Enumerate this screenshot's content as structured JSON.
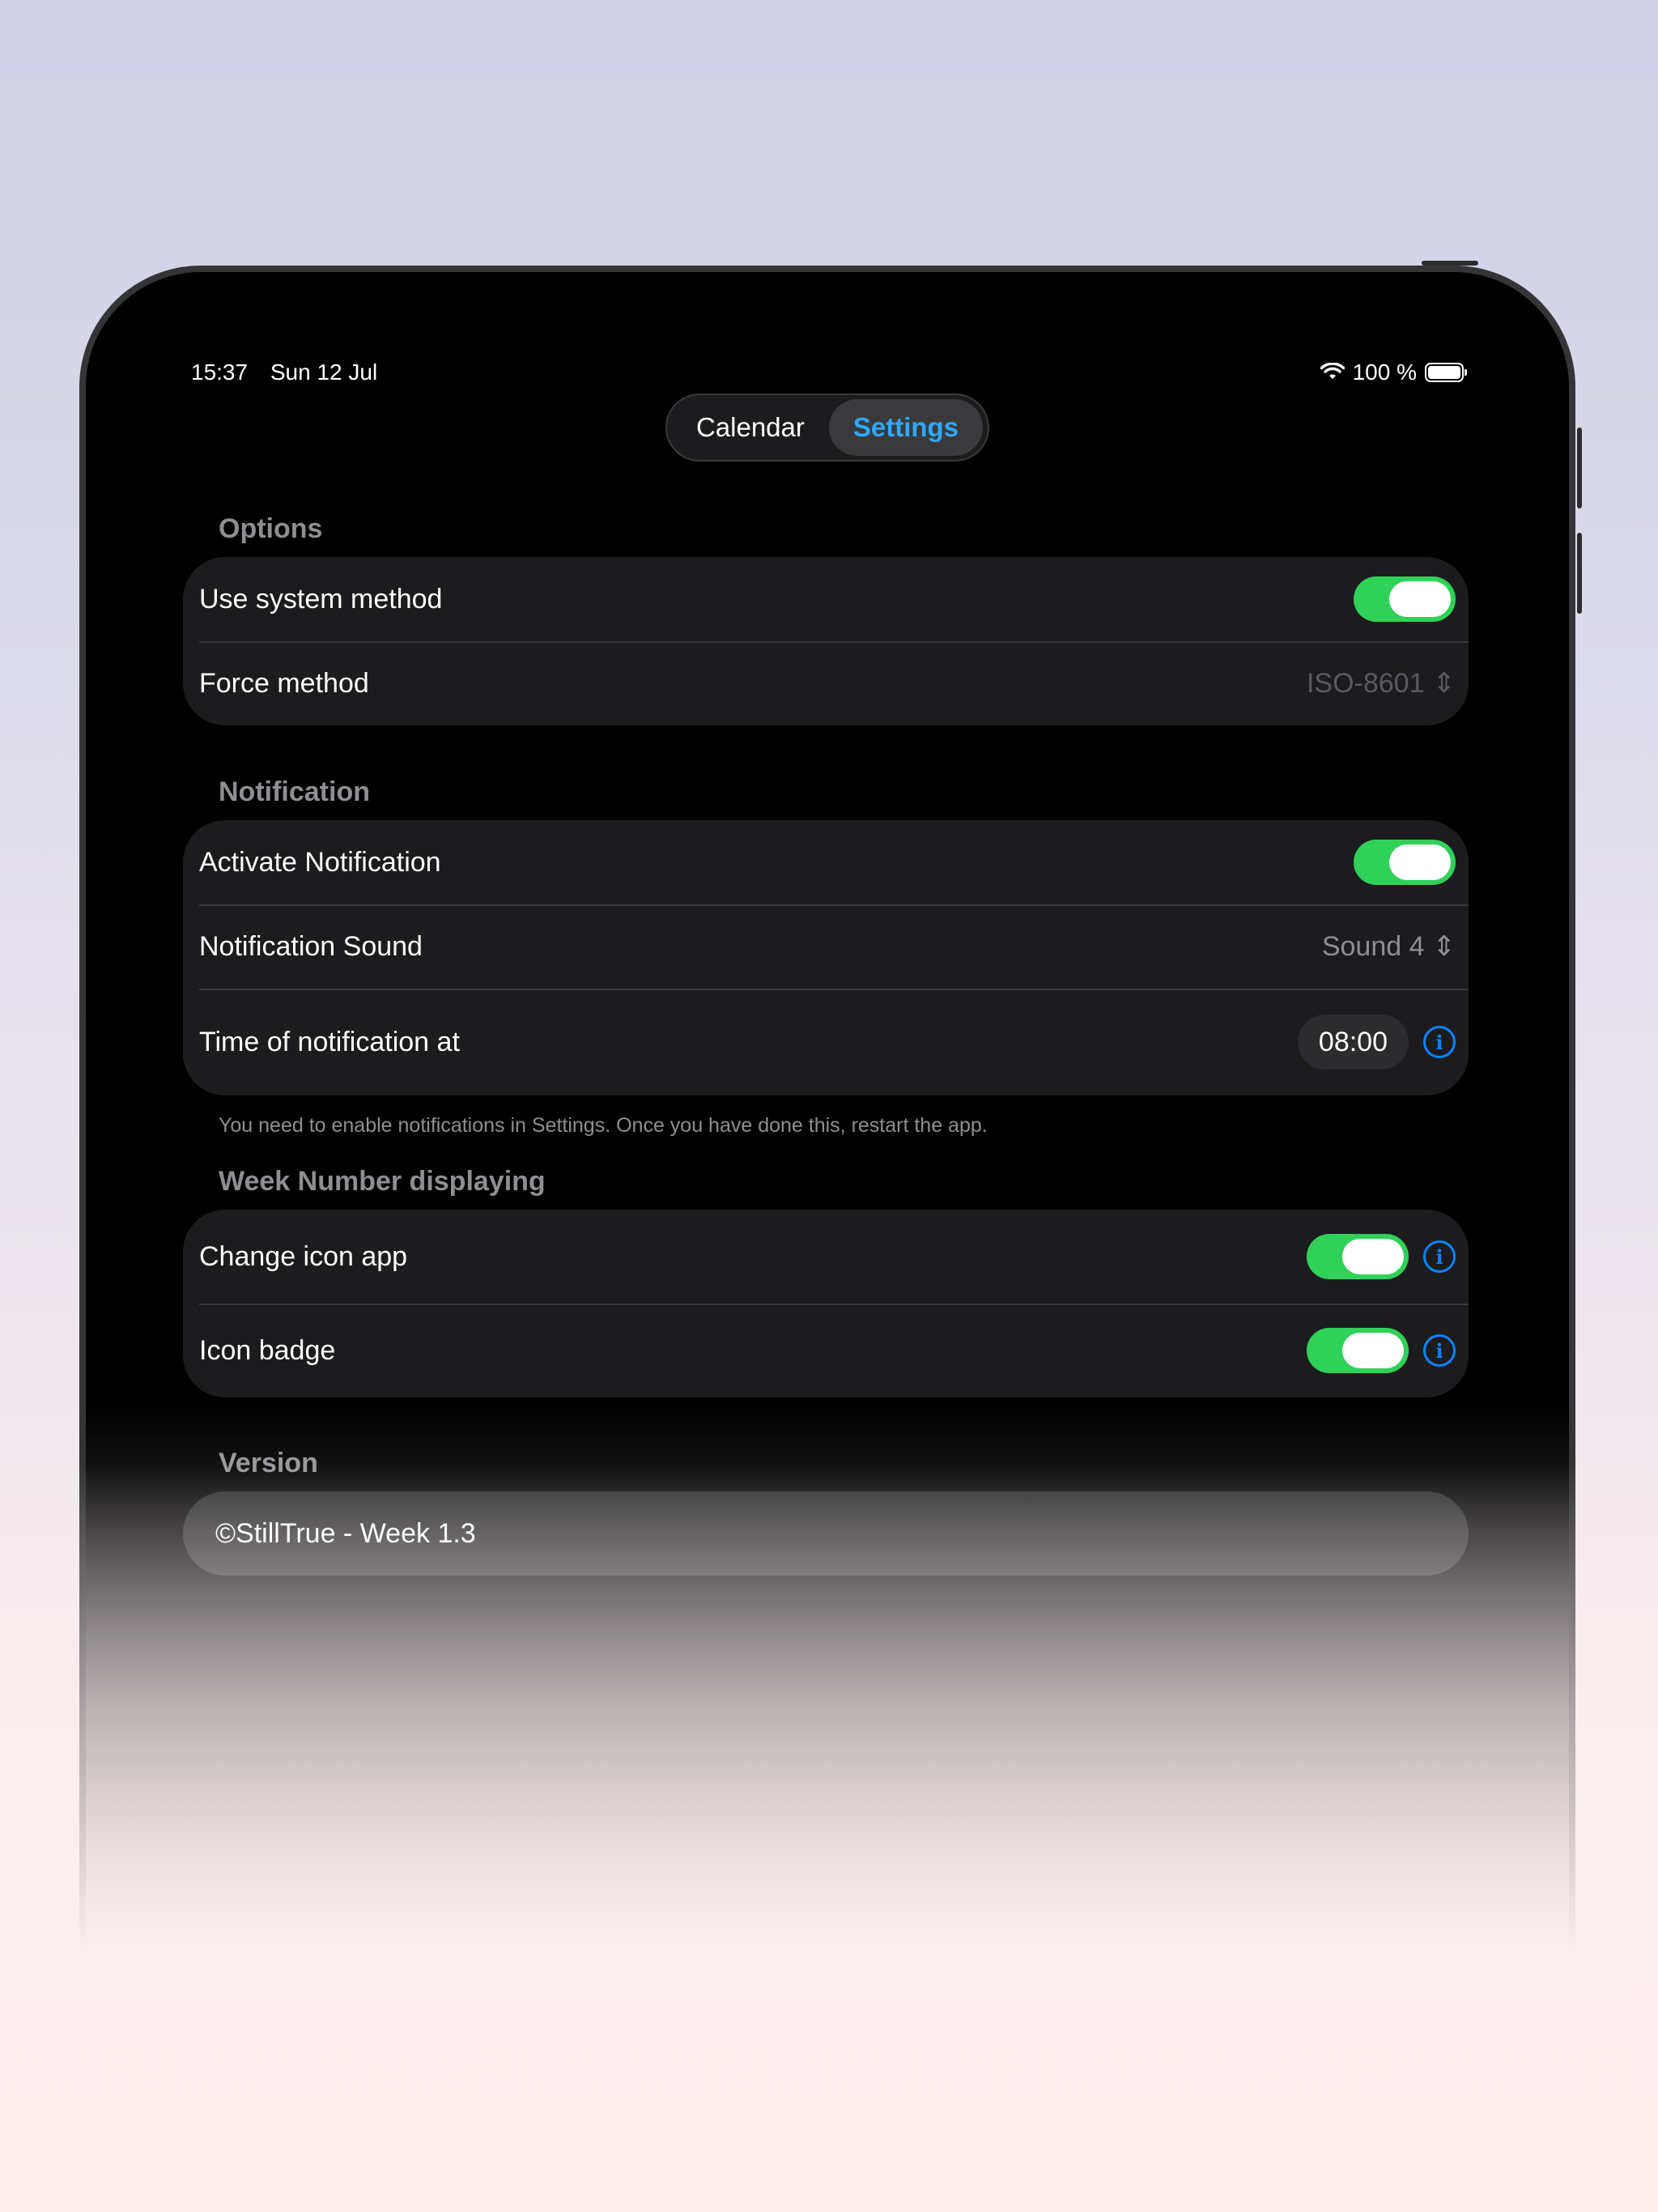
{
  "status_bar": {
    "time": "15:37",
    "date": "Sun 12 Jul",
    "battery": "100 %",
    "wifi_icon": "wifi-icon",
    "battery_icon": "battery-icon"
  },
  "tabs": [
    {
      "label": "Calendar",
      "active": false
    },
    {
      "label": "Settings",
      "active": true
    }
  ],
  "options": {
    "title": "Options",
    "use_system_method": {
      "label": "Use system method",
      "on": true
    },
    "force_method": {
      "label": "Force method",
      "value": "ISO-8601"
    }
  },
  "notification": {
    "title": "Notification",
    "activate": {
      "label": "Activate Notification",
      "on": true
    },
    "sound": {
      "label": "Notification Sound",
      "value": "Sound 4"
    },
    "time": {
      "label": "Time of notification at",
      "value": "08:00"
    },
    "footnote": "You need to enable notifications in Settings. Once you have done this, restart the app."
  },
  "week_display": {
    "title": "Week Number displaying",
    "change_icon": {
      "label": "Change icon app",
      "on": true
    },
    "icon_badge": {
      "label": "Icon badge",
      "on": true
    }
  },
  "version": {
    "title": "Version",
    "text": "©StillTrue - Week 1.3"
  },
  "colors": {
    "accent": "#0a84ff",
    "toggle_on": "#30d158",
    "active_tab": "#2ea8ff"
  }
}
